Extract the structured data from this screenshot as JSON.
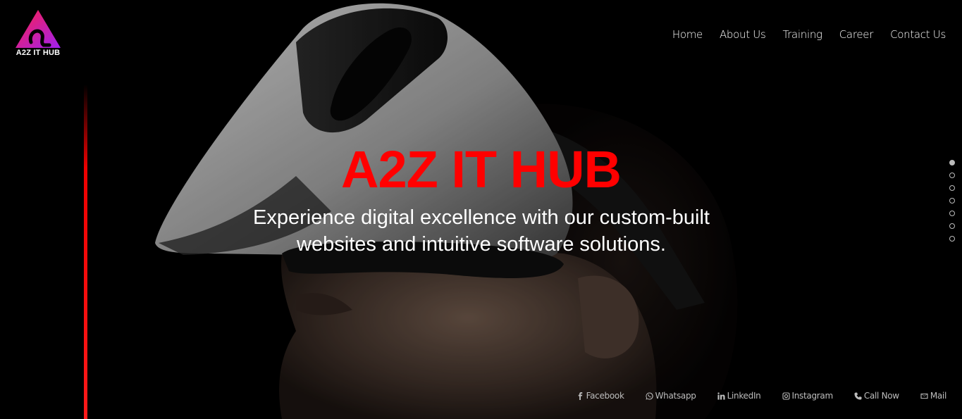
{
  "brand": {
    "name": "A2Z IT HUB",
    "logo_gradient": [
      "#ff1f4b",
      "#a020f0"
    ]
  },
  "nav": {
    "items": [
      {
        "label": "Home"
      },
      {
        "label": "About Us"
      },
      {
        "label": "Training"
      },
      {
        "label": "Career"
      },
      {
        "label": "Contact Us"
      }
    ]
  },
  "hero": {
    "title": "A2Z IT HUB",
    "tagline": "Experience digital excellence with our custom-built websites and intuitive software solutions.",
    "title_color": "#ff0000",
    "accent_line_color": "#ff0000"
  },
  "slider": {
    "total_slides": 7,
    "active_slide": 1
  },
  "social": {
    "items": [
      {
        "label": "Facebook",
        "icon": "facebook-icon"
      },
      {
        "label": "Whatsapp",
        "icon": "whatsapp-icon"
      },
      {
        "label": "LinkedIn",
        "icon": "linkedin-icon"
      },
      {
        "label": "Instagram",
        "icon": "instagram-icon"
      },
      {
        "label": "Call Now",
        "icon": "phone-icon"
      },
      {
        "label": "Mail",
        "icon": "mail-icon"
      }
    ]
  }
}
